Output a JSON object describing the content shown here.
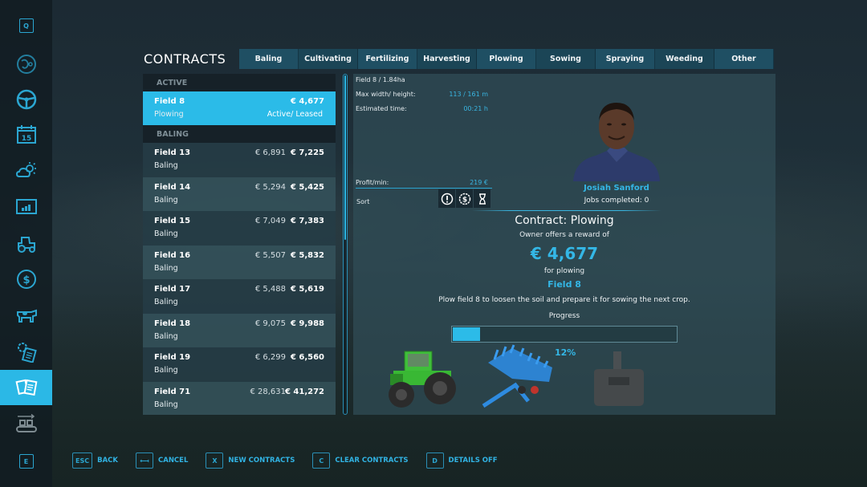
{
  "sidebar": {
    "top_key": "Q",
    "bottom_key": "E",
    "items": [
      {
        "icon": "map-icon",
        "label": "Map"
      },
      {
        "icon": "steering-wheel-icon",
        "label": "Vehicles"
      },
      {
        "icon": "calendar-icon",
        "label": "Calendar",
        "calendar_day": "15"
      },
      {
        "icon": "weather-icon",
        "label": "Weather"
      },
      {
        "icon": "statistics-icon",
        "label": "Statistics"
      },
      {
        "icon": "tractor-icon",
        "label": "Garage"
      },
      {
        "icon": "dollar-icon",
        "label": "Finances"
      },
      {
        "icon": "cow-icon",
        "label": "Animals"
      },
      {
        "icon": "production-icon",
        "label": "Production"
      },
      {
        "icon": "contracts-icon",
        "label": "Contracts",
        "active": true
      },
      {
        "icon": "conveyor-icon",
        "label": "Transport"
      }
    ]
  },
  "header": {
    "title": "CONTRACTS",
    "tabs": [
      "Baling",
      "Cultivating",
      "Fertilizing",
      "Harvesting",
      "Plowing",
      "Sowing",
      "Spraying",
      "Weeding",
      "Other"
    ]
  },
  "list": {
    "active_header": "ACTIVE",
    "active_item": {
      "name": "Field 8",
      "type": "Plowing",
      "reward": "€ 4,677",
      "status": "Active/ Leased"
    },
    "baling_header": "BALING",
    "items": [
      {
        "name": "Field 13",
        "type": "Baling",
        "original": "€ 6,891",
        "reward": "€ 7,225"
      },
      {
        "name": "Field 14",
        "type": "Baling",
        "original": "€ 5,294",
        "reward": "€ 5,425"
      },
      {
        "name": "Field 15",
        "type": "Baling",
        "original": "€ 7,049",
        "reward": "€ 7,383"
      },
      {
        "name": "Field 16",
        "type": "Baling",
        "original": "€ 5,507",
        "reward": "€ 5,832"
      },
      {
        "name": "Field 17",
        "type": "Baling",
        "original": "€ 5,488",
        "reward": "€ 5,619"
      },
      {
        "name": "Field 18",
        "type": "Baling",
        "original": "€ 9,075",
        "reward": "€ 9,988"
      },
      {
        "name": "Field 19",
        "type": "Baling",
        "original": "€ 6,299",
        "reward": "€ 6,560"
      },
      {
        "name": "Field 71",
        "type": "Baling",
        "original": "€ 28,631",
        "reward": "€ 41,272"
      }
    ]
  },
  "detail": {
    "field_info": "Field 8 / 1.84ha",
    "max_size_label": "Max width/ height:",
    "max_size_value": "113 / 161 m",
    "time_label": "Estimated time:",
    "time_value": "00:21 h",
    "profit_label": "Profit/min:",
    "profit_value": "219 €",
    "sort_label": "Sort",
    "sort_options": [
      "priority-icon",
      "money-icon",
      "hourglass-icon"
    ],
    "npc_name": "Josiah Sanford",
    "jobs_completed": "Jobs completed: 0",
    "contract_title": "Contract: Plowing",
    "reward_intro": "Owner offers a reward of",
    "reward_amount": "€ 4,677",
    "for_text": "for plowing",
    "field_name": "Field 8",
    "description": "Plow field 8 to loosen the soil and prepare it for sowing the next crop.",
    "progress_label": "Progress",
    "progress_percent": 12,
    "progress_text": "12%",
    "vehicles": [
      "tractor",
      "cultivator-plow",
      "front-weight"
    ]
  },
  "footer": [
    {
      "key": "ESC",
      "label": "BACK"
    },
    {
      "key": "⟻",
      "label": "CANCEL"
    },
    {
      "key": "X",
      "label": "NEW CONTRACTS"
    },
    {
      "key": "C",
      "label": "CLEAR CONTRACTS"
    },
    {
      "key": "D",
      "label": "DETAILS OFF"
    }
  ],
  "colors": {
    "accent": "#2bbbe8",
    "panel": "#304e58",
    "text": "#ffffff"
  }
}
